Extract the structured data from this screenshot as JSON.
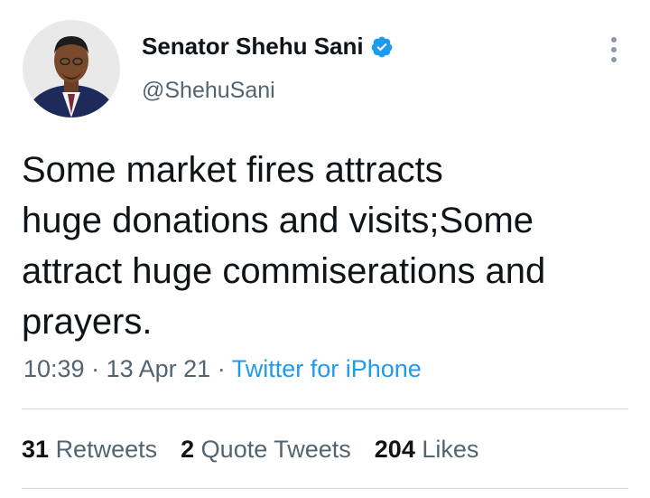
{
  "author": {
    "display_name": "Senator Shehu Sani",
    "handle": "@ShehuSani",
    "verified": true
  },
  "tweet": {
    "text_lines": [
      "Some market fires attracts",
      "huge donations and visits;Some",
      "attract huge commiserations and",
      "prayers."
    ],
    "time": "10:39",
    "separator": "·",
    "date": "13 Apr 21",
    "source": "Twitter for iPhone"
  },
  "stats": {
    "retweets_count": "31",
    "retweets_label": "Retweets",
    "quotes_count": "2",
    "quotes_label": "Quote Tweets",
    "likes_count": "204",
    "likes_label": "Likes"
  },
  "colors": {
    "accent": "#1d9bf0",
    "text_primary": "#0f1419",
    "text_secondary": "#536471",
    "divider": "#cfd9de"
  },
  "icons": {
    "verified": "verified-badge-icon",
    "more": "more-options-icon"
  }
}
